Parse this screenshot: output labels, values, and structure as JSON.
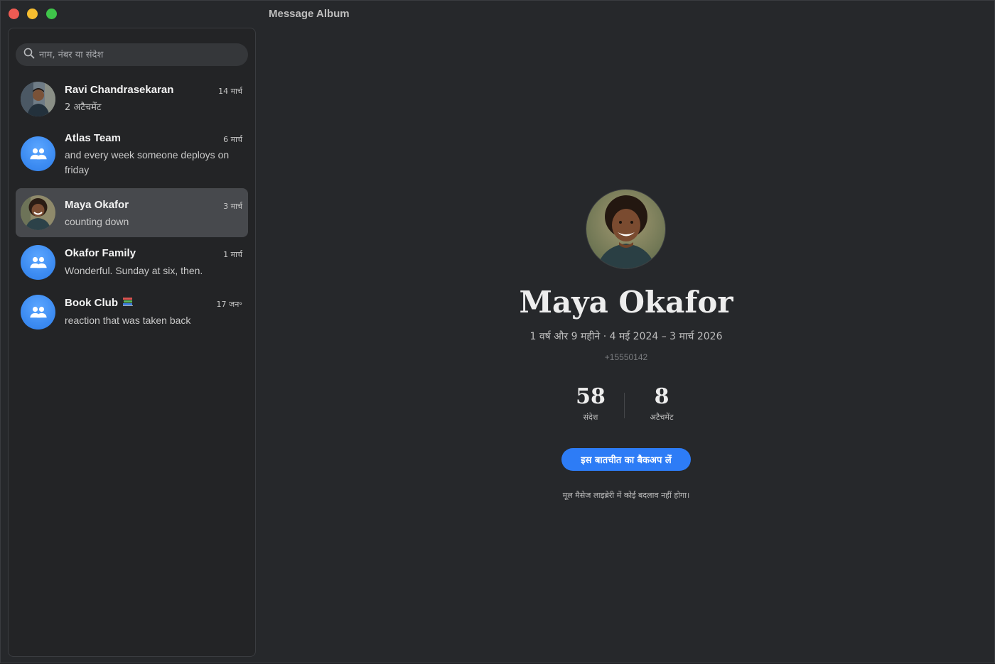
{
  "app": {
    "title": "Message Album"
  },
  "search": {
    "placeholder": "नाम, नंबर या संदेश"
  },
  "conversations": [
    {
      "name": "Ravi Chandrasekaran",
      "date": "14 मार्च",
      "preview": "2 अटैचमेंट",
      "avatar": "person-photo-icon",
      "selected": false
    },
    {
      "name": "Atlas Team",
      "date": "6 मार्च",
      "preview": "and every week someone deploys on friday",
      "avatar": "group-icon",
      "selected": false
    },
    {
      "name": "Maya Okafor",
      "date": "3 मार्च",
      "preview": "counting down",
      "avatar": "person-photo-icon",
      "selected": true
    },
    {
      "name": "Okafor Family",
      "date": "1 मार्च",
      "preview": "Wonderful. Sunday at six, then.",
      "avatar": "group-icon",
      "selected": false
    },
    {
      "name": "Book Club",
      "emoji": "books-icon",
      "date": "17 जन॰",
      "preview": "reaction that was taken back",
      "avatar": "group-icon",
      "selected": false
    }
  ],
  "detail": {
    "name": "Maya Okafor",
    "span": "1 वर्ष और 9 महीने · 4 मई 2024 – 3 मार्च 2026",
    "phone": "+15550142",
    "stats": [
      {
        "value": "58",
        "label": "संदेश"
      },
      {
        "value": "8",
        "label": "अटैचमेंट"
      }
    ],
    "backup_label": "इस बातचीत का बैकअप लें",
    "note": "मूल मैसेज लाइब्रेरी में कोई बदलाव नहीं होगा।"
  },
  "colors": {
    "accent": "#2d7cf6",
    "group_avatar": "#3d8cf2",
    "selected_row": "#47494d"
  }
}
